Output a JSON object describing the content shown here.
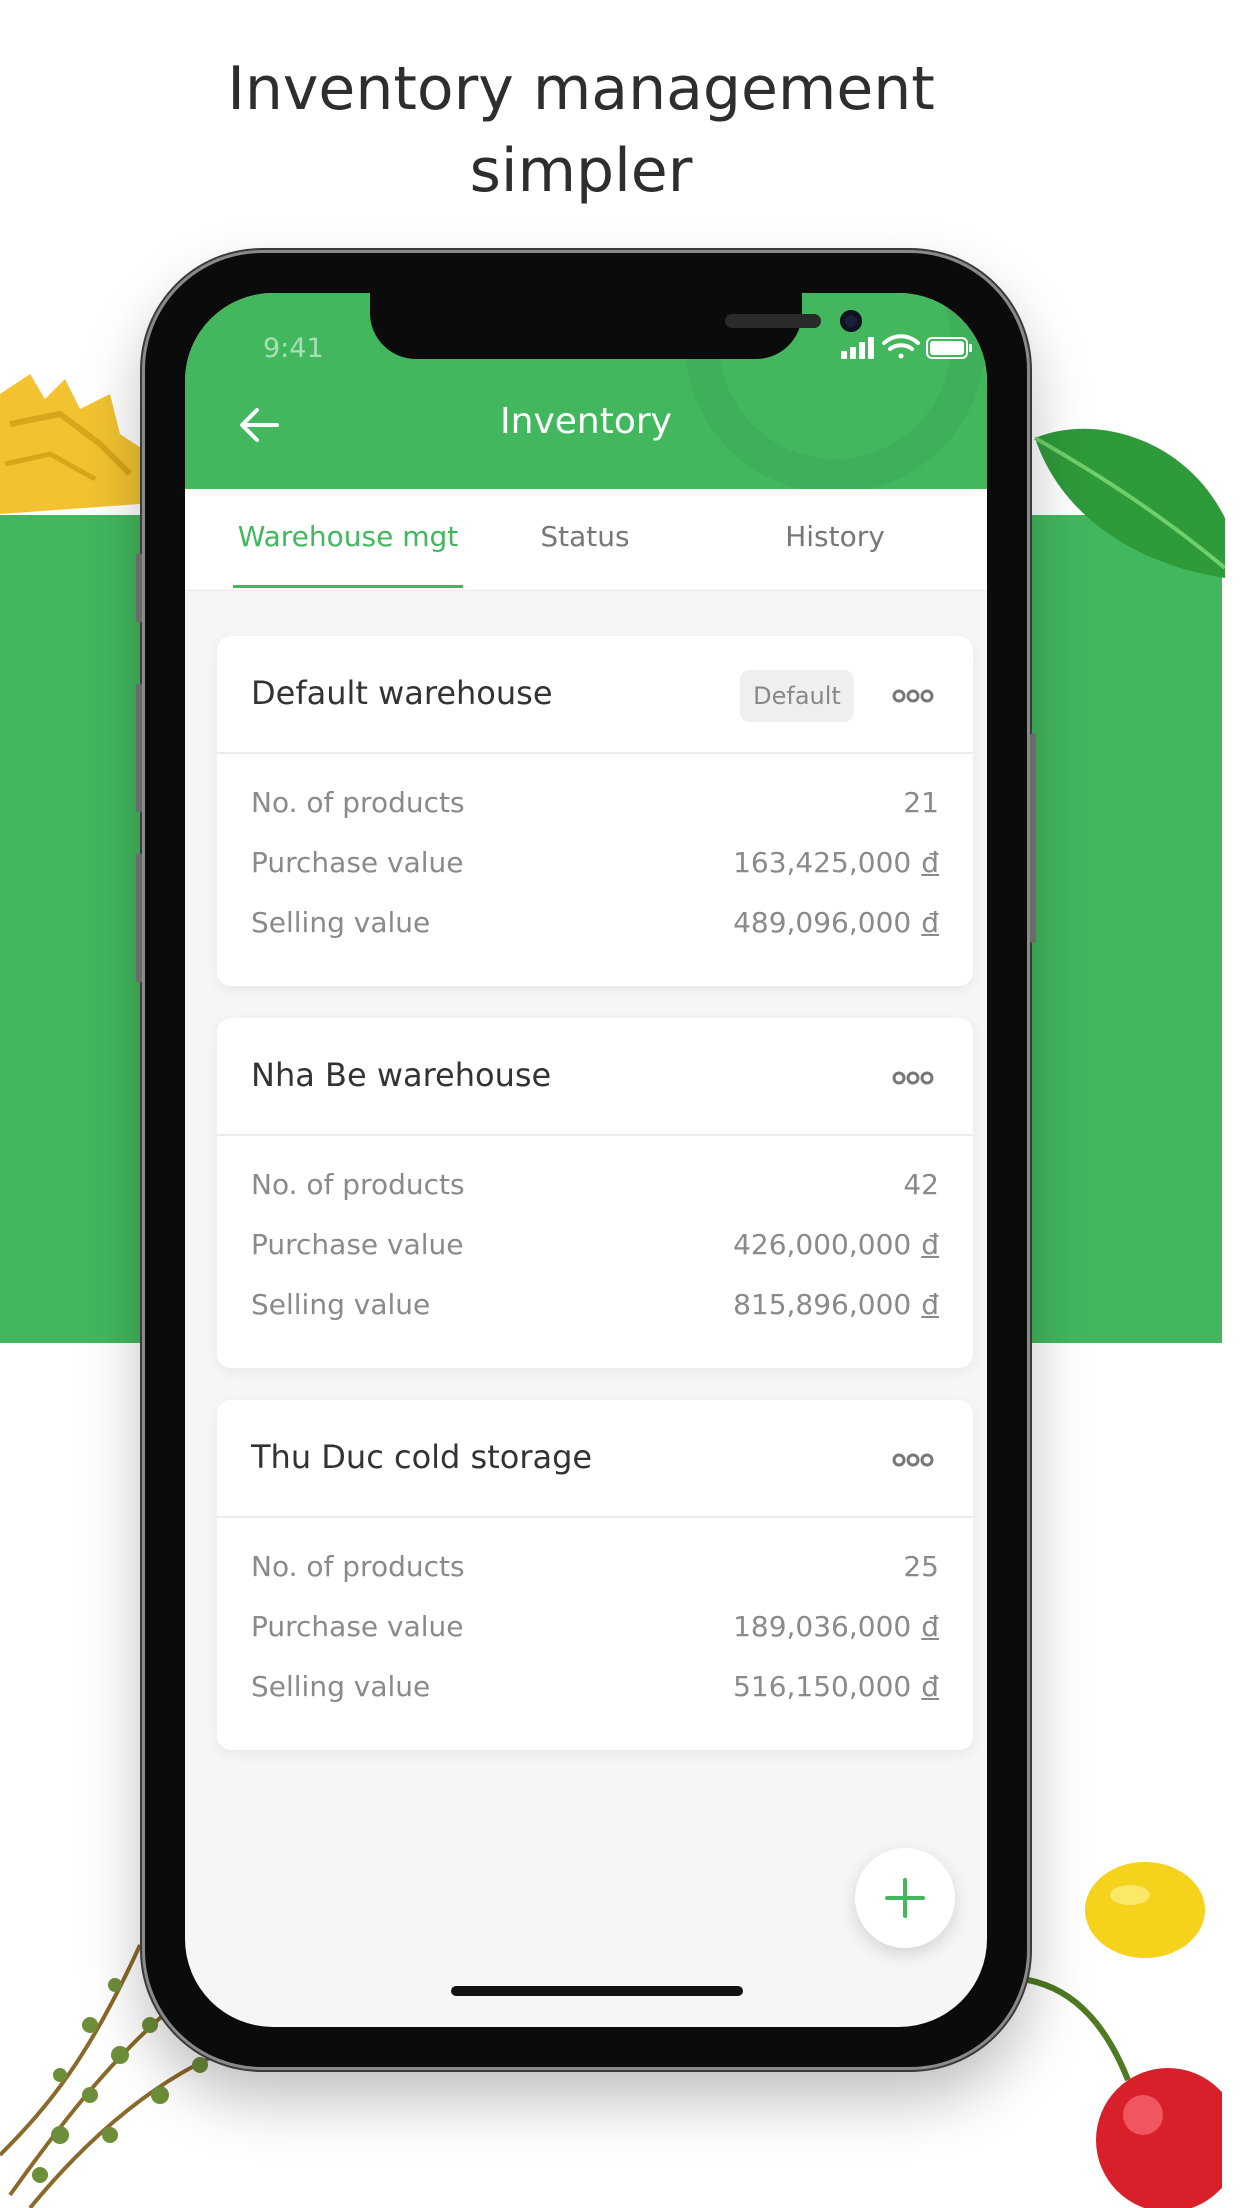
{
  "headline": {
    "line1": "Inventory management",
    "line2": "simpler"
  },
  "status_bar": {
    "time": "9:41"
  },
  "nav": {
    "title": "Inventory"
  },
  "tabs": [
    {
      "label": "Warehouse mgt",
      "active": true
    },
    {
      "label": "Status",
      "active": false
    },
    {
      "label": "History",
      "active": false
    }
  ],
  "warehouses": [
    {
      "name": "Default warehouse",
      "badge": "Default",
      "rows": [
        {
          "label": "No. of products",
          "value": "21",
          "currency": ""
        },
        {
          "label": "Purchase value",
          "value": "163,425,000",
          "currency": "đ"
        },
        {
          "label": "Selling value",
          "value": "489,096,000",
          "currency": "đ"
        }
      ]
    },
    {
      "name": "Nha Be warehouse",
      "rows": [
        {
          "label": "No. of products",
          "value": "42",
          "currency": ""
        },
        {
          "label": "Purchase value",
          "value": "426,000,000",
          "currency": "đ"
        },
        {
          "label": "Selling value",
          "value": "815,896,000",
          "currency": "đ"
        }
      ]
    },
    {
      "name": "Thu Duc cold storage",
      "rows": [
        {
          "label": "No. of products",
          "value": "25",
          "currency": ""
        },
        {
          "label": "Purchase value",
          "value": "189,036,000",
          "currency": "đ"
        },
        {
          "label": "Selling value",
          "value": "516,150,000",
          "currency": "đ"
        }
      ]
    }
  ],
  "icons": {
    "back": "arrow-left-icon",
    "more": "more-dots-icon",
    "add": "plus-icon",
    "signal": "signal-icon",
    "wifi": "wifi-icon",
    "battery": "battery-icon"
  },
  "colors": {
    "brand": "#42b75e",
    "background": "#f6f6f6",
    "text_muted": "#8a8a8a"
  }
}
